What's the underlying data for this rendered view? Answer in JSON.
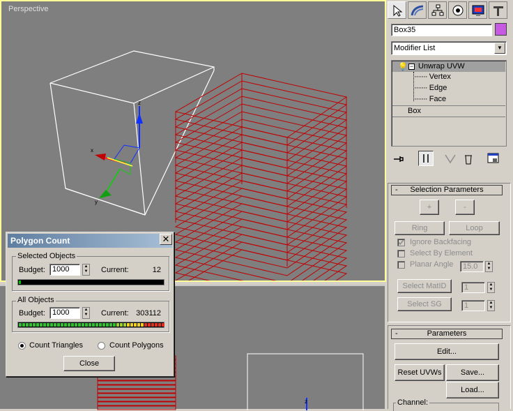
{
  "viewports": {
    "top": {
      "label": "Perspective"
    }
  },
  "panel": {
    "object_name": "Box35",
    "object_color": "#c65ae0",
    "modifier_list": "Modifier List",
    "stack": [
      {
        "label": "Unwrap UVW",
        "selected": true
      },
      {
        "label": "Vertex"
      },
      {
        "label": "Edge"
      },
      {
        "label": "Face"
      },
      {
        "label": "Box"
      }
    ],
    "selection_parameters": {
      "title": "Selection Parameters",
      "grow": "+",
      "shrink": "-",
      "ring": "Ring",
      "loop": "Loop",
      "ignore_backfacing": "Ignore Backfacing",
      "select_by_element": "Select By Element",
      "planar_angle": "Planar Angle",
      "planar_angle_value": "15.0",
      "select_matid": "Select MatID",
      "select_matid_value": "1",
      "select_sg": "Select SG",
      "select_sg_value": "1"
    },
    "parameters": {
      "title": "Parameters",
      "edit": "Edit...",
      "reset_uvws": "Reset UVWs",
      "save": "Save...",
      "load": "Load...",
      "channel": "Channel:"
    }
  },
  "dialog": {
    "title": "Polygon Count",
    "selected_objects": {
      "title": "Selected Objects",
      "budget_label": "Budget:",
      "budget_value": "1000",
      "current_label": "Current:",
      "current_value": "12"
    },
    "all_objects": {
      "title": "All Objects",
      "budget_label": "Budget:",
      "budget_value": "1000",
      "current_label": "Current:",
      "current_value": "303112"
    },
    "count_triangles": "Count Triangles",
    "count_polygons": "Count Polygons",
    "close": "Close"
  }
}
